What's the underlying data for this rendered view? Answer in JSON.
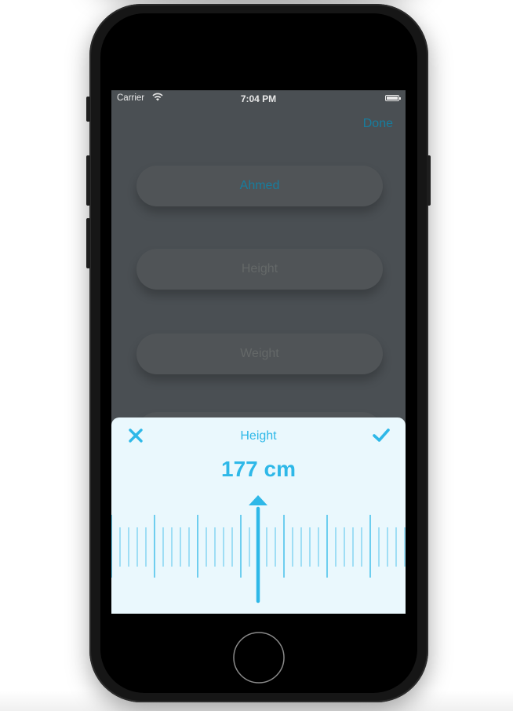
{
  "status_bar": {
    "carrier": "Carrier",
    "time": "7:04 PM"
  },
  "nav": {
    "done_label": "Done"
  },
  "form": {
    "name_value": "Ahmed",
    "height_placeholder": "Height",
    "weight_placeholder": "Weight"
  },
  "picker": {
    "title": "Height",
    "value_display": "177 cm",
    "value": 177,
    "unit": "cm",
    "close_icon": "close-x-icon",
    "confirm_icon": "checkmark-icon"
  },
  "colors": {
    "accent": "#2eb8e8",
    "accent_dim": "#177d9e",
    "sheet_bg": "#eaf8fd",
    "overlay_bg": "#4a4f53"
  }
}
